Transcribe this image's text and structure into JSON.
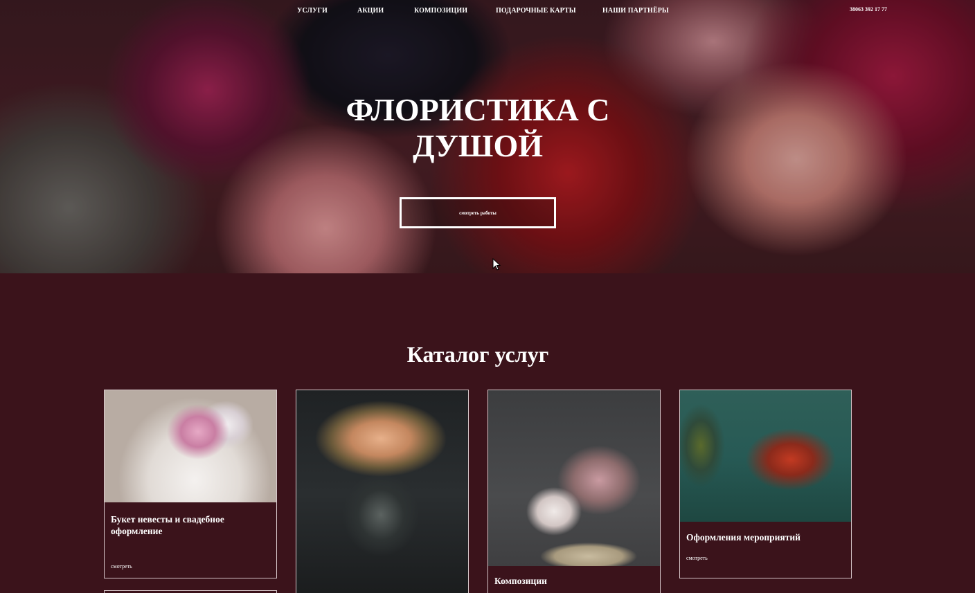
{
  "nav": {
    "items": [
      {
        "label": "УСЛУГИ"
      },
      {
        "label": "АКЦИИ"
      },
      {
        "label": "КОМПОЗИЦИИ"
      },
      {
        "label": "ПОДАРОЧНЫЕ КАРТЫ"
      },
      {
        "label": "НАШИ ПАРТНЁРЫ"
      }
    ],
    "phone": "38063 392 17 77"
  },
  "hero": {
    "title_line1": "ФЛОРИСТИКА С",
    "title_line2": "ДУШОЙ",
    "button_label": "смотреть работы"
  },
  "catalog": {
    "title": "Каталог услуг",
    "cards": [
      {
        "title_line1": "Букет невесты и свадебное",
        "title_line2": "оформление",
        "link": "смотреть"
      },
      {
        "title": ""
      },
      {
        "title": "Композиции"
      },
      {
        "title": "Оформления мероприятий",
        "link": "смотреть"
      }
    ]
  },
  "colors": {
    "background": "#3b131b",
    "text": "#ffffff",
    "card_border": "#d8c8cb"
  }
}
